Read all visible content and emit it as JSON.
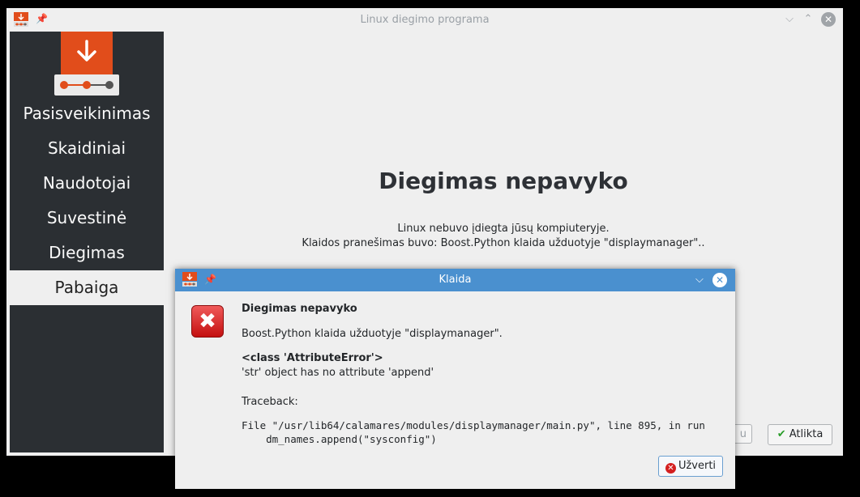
{
  "main_window": {
    "title": "Linux diegimo programa",
    "minimize_icon": "chevron-down-icon",
    "maximize_icon": "chevron-up-icon",
    "close_icon": "close-icon"
  },
  "sidebar": {
    "steps": [
      {
        "label": "Pasisveikinimas"
      },
      {
        "label": "Skaidiniai"
      },
      {
        "label": "Naudotojai"
      },
      {
        "label": "Suvestinė"
      },
      {
        "label": "Diegimas"
      },
      {
        "label": "Pabaiga",
        "active": true
      }
    ]
  },
  "content": {
    "heading": "Diegimas nepavyko",
    "line1": "Linux nebuvo įdiegta jūsų kompiuteryje.",
    "line2": "Klaidos pranešimas buvo: Boost.Python klaida užduotyje \"displaymanager\".."
  },
  "buttons": {
    "back_partial": "u",
    "done": "Atlikta"
  },
  "dialog": {
    "title": "Klaida",
    "heading": "Diegimas nepavyko",
    "message": "Boost.Python klaida užduotyje \"displaymanager\".",
    "error_class": "<class 'AttributeError'>",
    "error_detail": "'str' object has no attribute 'append'",
    "traceback_label": "Traceback:",
    "traceback_line1": "File \"/usr/lib64/calamares/modules/displaymanager/main.py\", line 895, in run",
    "traceback_line2": "    dm_names.append(\"sysconfig\")",
    "close_button": "Užverti"
  },
  "colors": {
    "accent_orange": "#e14d1b",
    "sidebar_bg": "#2b2f33",
    "dialog_titlebar": "#4a90cf",
    "window_bg": "#efefef"
  }
}
